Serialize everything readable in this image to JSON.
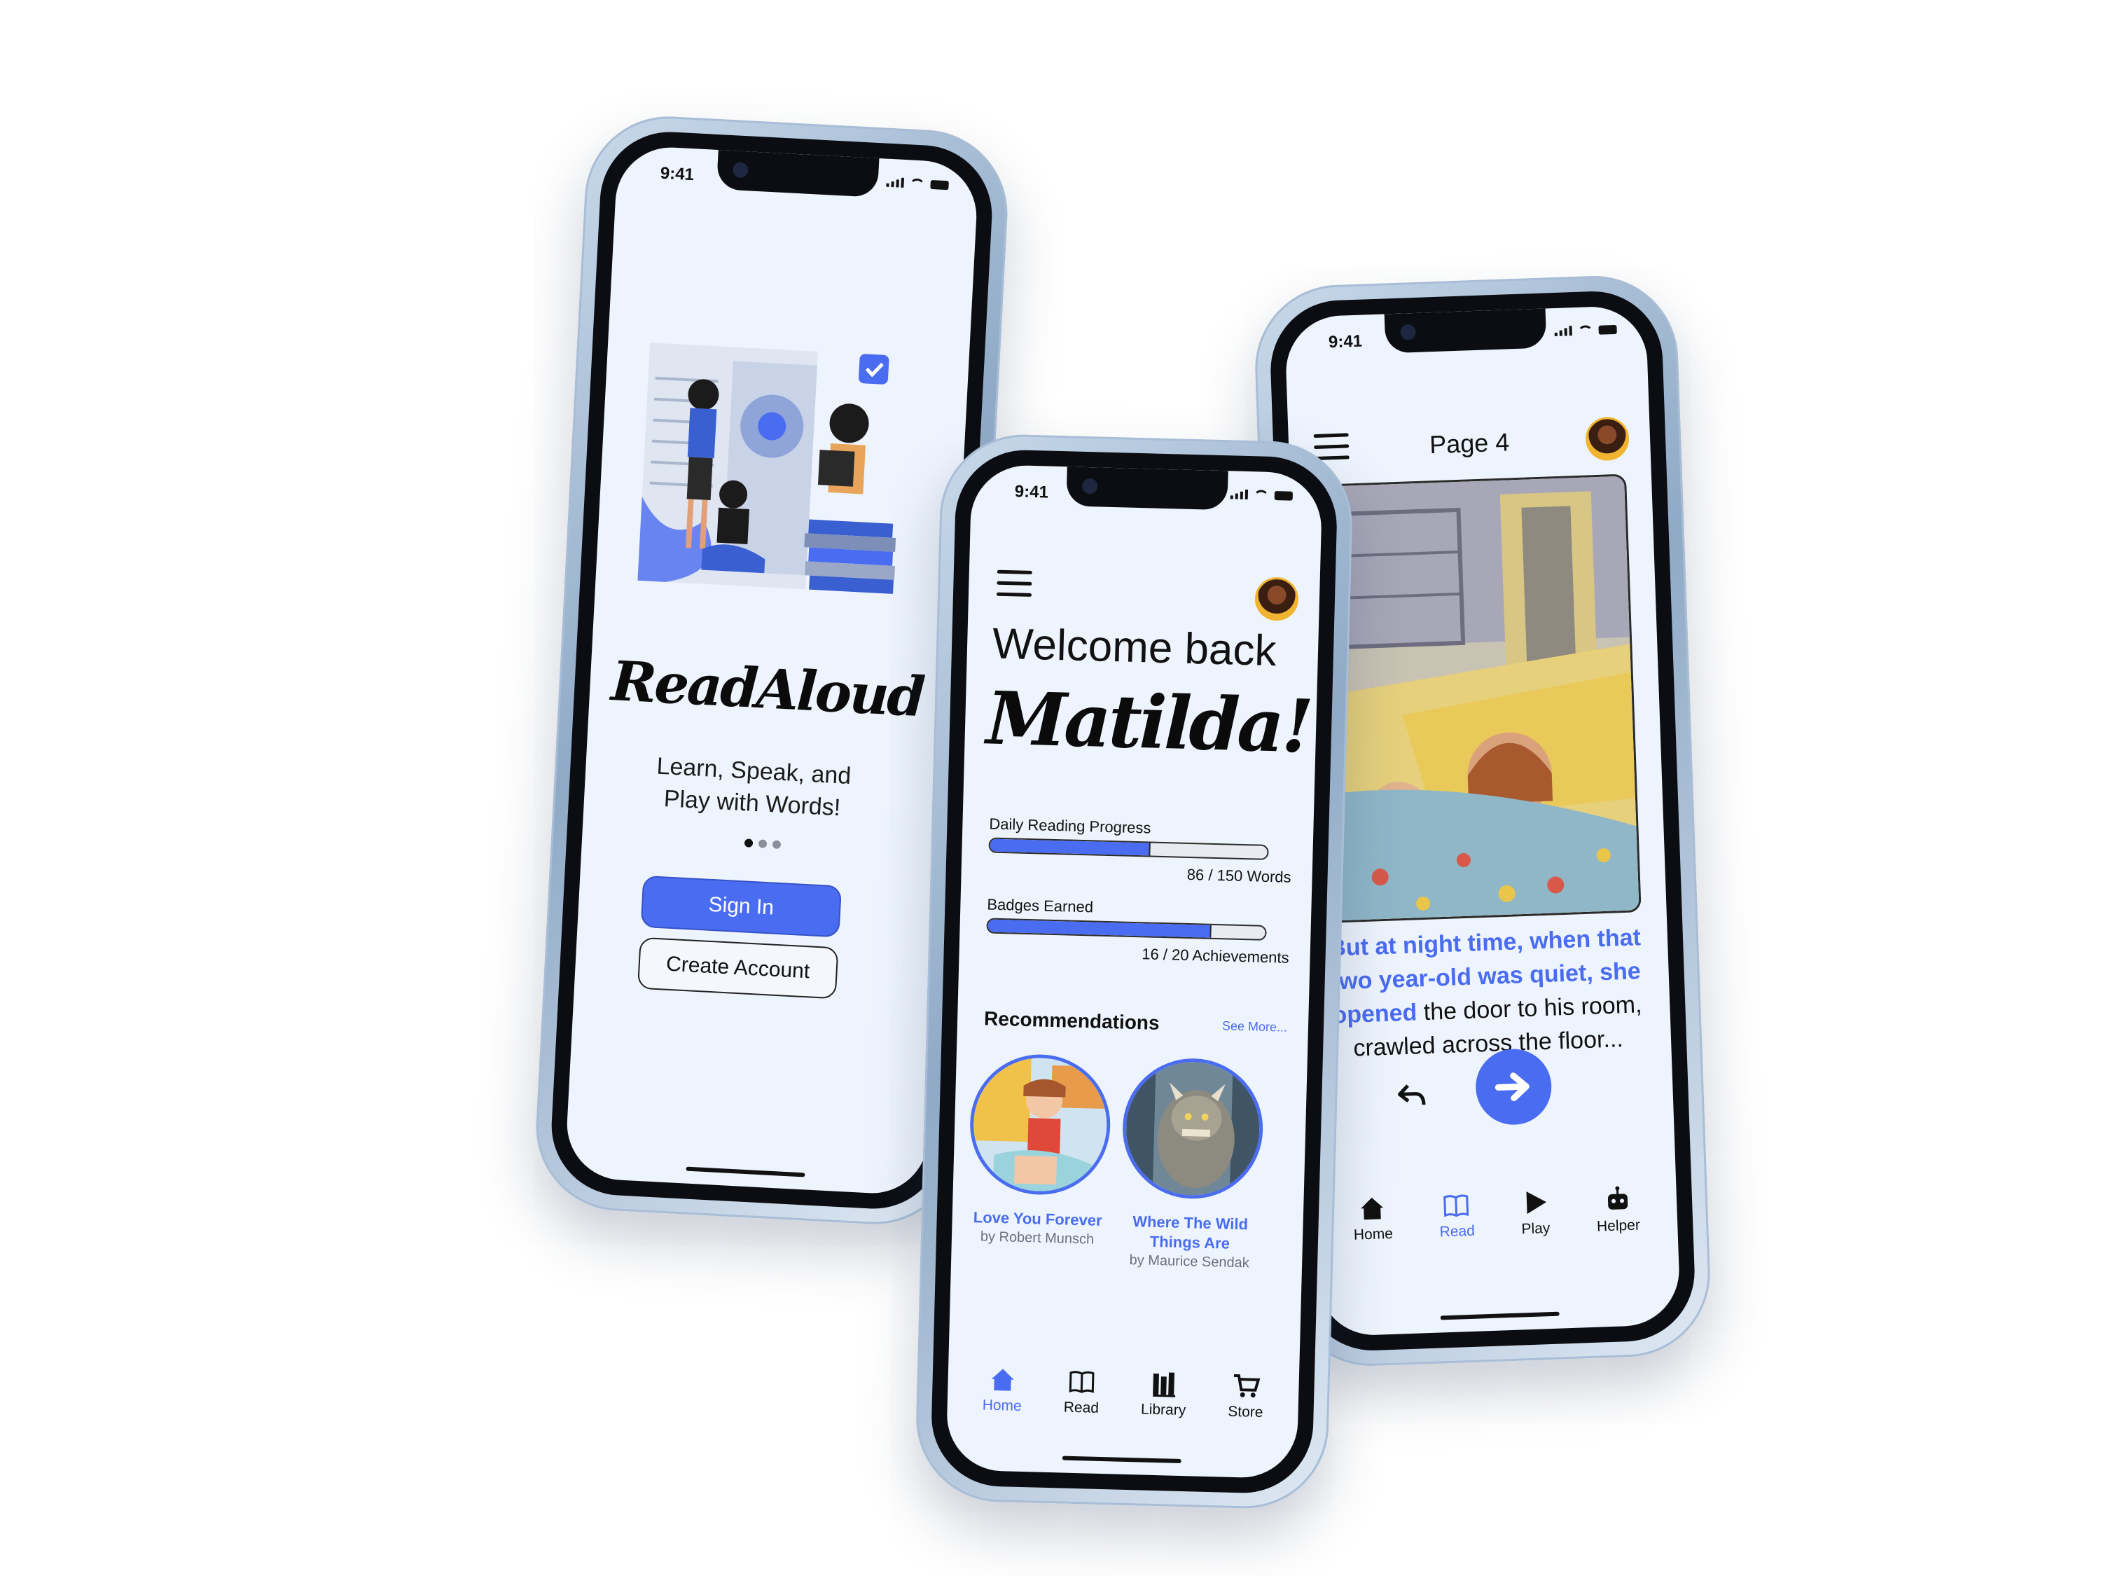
{
  "status": {
    "time": "9:41"
  },
  "onboarding": {
    "app_name": "ReadAloud",
    "tagline_line1": "Learn, Speak, and",
    "tagline_line2": "Play with Words!",
    "sign_in_label": "Sign In",
    "create_account_label": "Create Account",
    "page_dots": 3,
    "active_dot": 0
  },
  "home": {
    "welcome": "Welcome back",
    "user_name": "Matilda!",
    "daily_progress": {
      "label": "Daily Reading Progress",
      "value_text": "86 / 150 Words",
      "current": 86,
      "total": 150
    },
    "badges": {
      "label": "Badges Earned",
      "value_text": "16 / 20 Achievements",
      "current": 16,
      "total": 20
    },
    "recommendations_title": "Recommendations",
    "see_more": "See More...",
    "books": [
      {
        "title": "Love You Forever",
        "author": "by Robert Munsch"
      },
      {
        "title_line1": "Where The Wild",
        "title_line2": "Things Are",
        "author": "by Maurice Sendak"
      }
    ],
    "tabs": [
      {
        "label": "Home",
        "icon": "home-icon",
        "active": true
      },
      {
        "label": "Read",
        "icon": "book-icon",
        "active": false
      },
      {
        "label": "Library",
        "icon": "library-icon",
        "active": false
      },
      {
        "label": "Store",
        "icon": "cart-icon",
        "active": false
      }
    ]
  },
  "reader": {
    "page_title": "Page 4",
    "story_highlight": "But at night time, when that two year-old was quiet, she opened",
    "story_rest": " the door to his room, crawled across the floor...",
    "tabs": [
      {
        "label": "Home",
        "icon": "home-icon",
        "active": false
      },
      {
        "label": "Read",
        "icon": "book-icon",
        "active": true
      },
      {
        "label": "Play",
        "icon": "play-icon",
        "active": false
      },
      {
        "label": "Helper",
        "icon": "robot-icon",
        "active": false
      }
    ]
  },
  "colors": {
    "accent": "#4a6cf0",
    "screen_bg": "#eef4fd",
    "text": "#111111"
  }
}
